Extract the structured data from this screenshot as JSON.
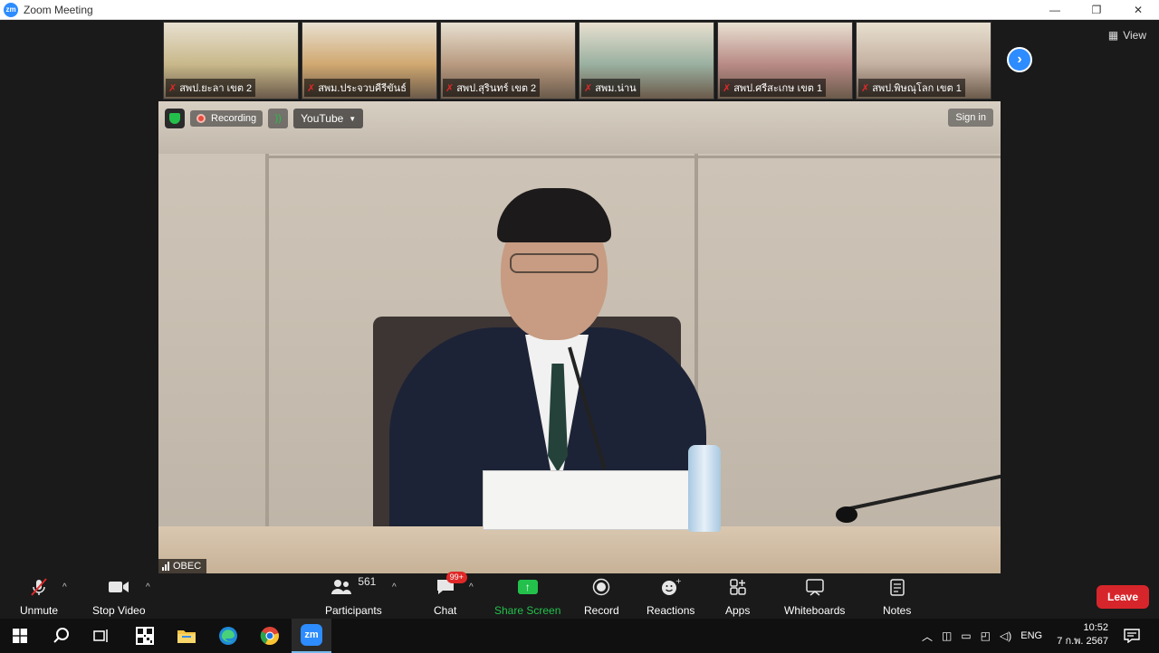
{
  "window": {
    "app_icon": "zm",
    "title": "Zoom Meeting",
    "controls": {
      "minimize": "—",
      "restore": "❐",
      "close": "✕"
    }
  },
  "gallery": {
    "thumbnails": [
      {
        "label": "สพป.ยะลา เขต 2",
        "muted": true,
        "scene_color": "#c8b88a"
      },
      {
        "label": "สพม.ประจวบคีรีขันธ์",
        "muted": true,
        "scene_color": "#d0a870"
      },
      {
        "label": "สพป.สุรินทร์ เขต 2",
        "muted": true,
        "scene_color": "#b89a80"
      },
      {
        "label": "สพม.น่าน",
        "muted": true,
        "scene_color": "#9ab0a0"
      },
      {
        "label": "สพป.ศรีสะเกษ เขต 1",
        "muted": true,
        "scene_color": "#b88a86"
      },
      {
        "label": "สพป.พิษณุโลก เขต 1",
        "muted": true,
        "scene_color": "#c4b0a0"
      }
    ],
    "next_icon": "›",
    "view_label": "View"
  },
  "stage": {
    "recording_label": "Recording",
    "stream_label": "YouTube",
    "signin_label": "Sign in",
    "speaker_name": "OBEC"
  },
  "toolbar": {
    "unmute": "Unmute",
    "stop_video": "Stop Video",
    "participants": "Participants",
    "participants_count": "561",
    "chat": "Chat",
    "chat_badge": "99+",
    "share_screen": "Share Screen",
    "record": "Record",
    "reactions": "Reactions",
    "apps": "Apps",
    "whiteboards": "Whiteboards",
    "notes": "Notes",
    "leave": "Leave"
  },
  "taskbar": {
    "zoom_app": "zm",
    "language": "ENG",
    "time": "10:52",
    "date": "7 ก.พ. 2567"
  },
  "colors": {
    "accent": "#2d8cff",
    "share_green": "#23c14b",
    "leave_red": "#d7262b",
    "muted_red": "#e02828"
  }
}
